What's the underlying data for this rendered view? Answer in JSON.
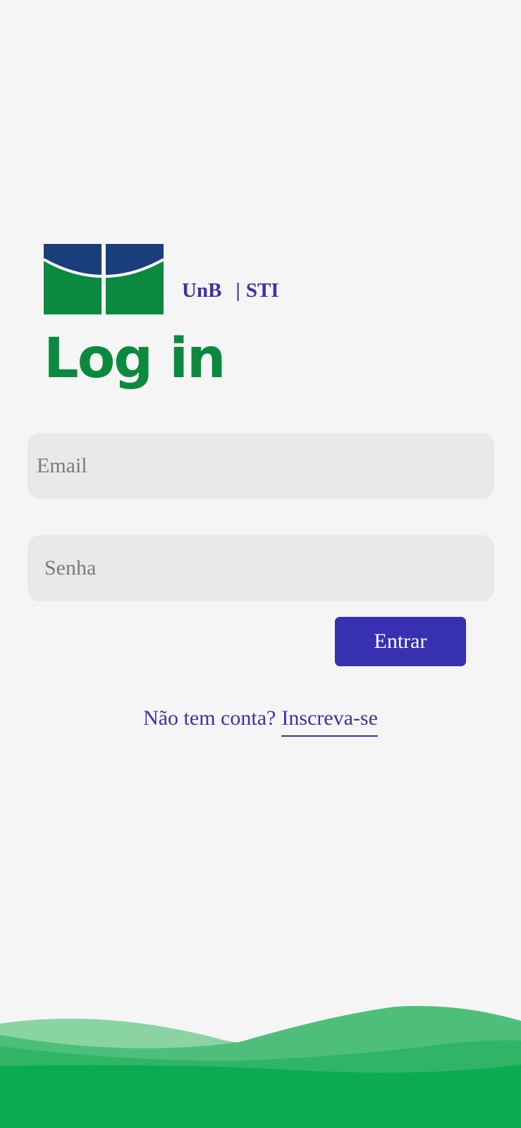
{
  "brand": {
    "left": "UnB",
    "separator": "|",
    "right": "STI"
  },
  "title": "Log in",
  "form": {
    "email_placeholder": "Email",
    "password_placeholder": "Senha",
    "submit_label": "Entrar"
  },
  "signup": {
    "prompt": "Não tem conta?",
    "link_label": "Inscreva-se"
  },
  "colors": {
    "background": "#f5f5f5",
    "brand_primary": "#3730b0",
    "title_green": "#0b8a3f",
    "logo_blue": "#1a3d7c",
    "logo_green": "#0b8a3f",
    "wave_green": "#0bab52"
  }
}
